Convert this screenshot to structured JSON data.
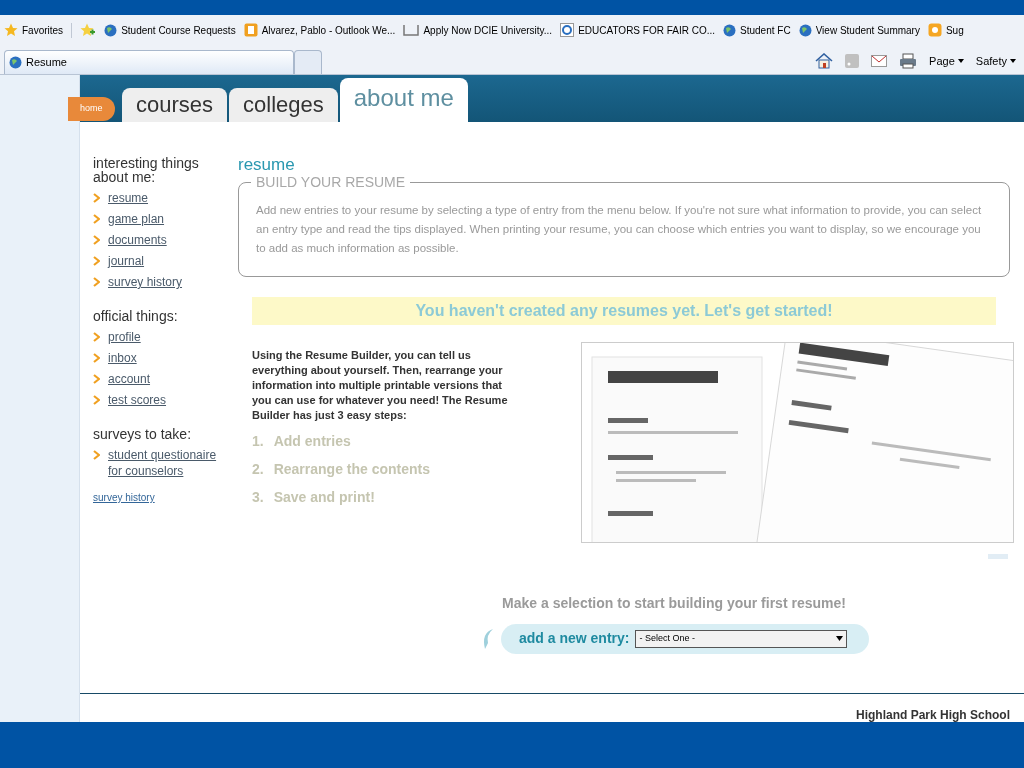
{
  "favorites_bar": {
    "label": "Favorites",
    "links": [
      {
        "label": "Student Course Requests",
        "kind": "globe"
      },
      {
        "label": "Alvarez, Pablo - Outlook We...",
        "kind": "outlook"
      },
      {
        "label": "Apply Now  DCIE  University...",
        "kind": "page"
      },
      {
        "label": "EDUCATORS FOR FAIR CO...",
        "kind": "ie"
      },
      {
        "label": "Student FC",
        "kind": "globe"
      },
      {
        "label": "View Student Summary",
        "kind": "globe"
      },
      {
        "label": "Sug",
        "kind": "web"
      }
    ]
  },
  "browser_tab": {
    "title": "Resume"
  },
  "command_bar": {
    "menus": [
      "Page",
      "Safety"
    ]
  },
  "site_nav": {
    "home": "home",
    "tabs": [
      {
        "label": "courses",
        "selected": false
      },
      {
        "label": "colleges",
        "selected": false
      },
      {
        "label": "about me",
        "selected": true
      }
    ]
  },
  "sidebar": {
    "sections": [
      {
        "title": "interesting things about me:",
        "links": [
          "resume",
          "game plan",
          "documents",
          "journal",
          "survey history"
        ]
      },
      {
        "title": "official things:",
        "links": [
          "profile",
          "inbox",
          "account",
          "test scores"
        ]
      },
      {
        "title": "surveys to take:",
        "links": [
          "student questionaire for counselors"
        ]
      }
    ],
    "footer_link": "survey history"
  },
  "main": {
    "title": "resume",
    "box_legend": "BUILD YOUR RESUME",
    "box_text": "Add new entries to your resume by selecting a type of entry from the menu below. If you're not sure what information to provide, you can select an entry type and read the tips displayed. When printing your resume, you can choose which entries you want to display, so we encourage you to add as much information as possible.",
    "banner": "You haven't created any resumes yet. Let's get started!",
    "intro": "Using the Resume Builder, you can tell us everything about yourself. Then, rearrange your information into multiple printable versions that you can use for whatever you need! The Resume Builder has just 3 easy steps:",
    "steps": [
      {
        "number": "1.",
        "label": "Add entries"
      },
      {
        "number": "2.",
        "label": "Rearrange the contents"
      },
      {
        "number": "3.",
        "label": "Save and print!"
      }
    ],
    "prompt": "Make a selection to start building your first resume!",
    "entry_label": "add a new entry:",
    "entry_select": "- Select One -"
  },
  "footer": {
    "school": "Highland Park High School"
  }
}
